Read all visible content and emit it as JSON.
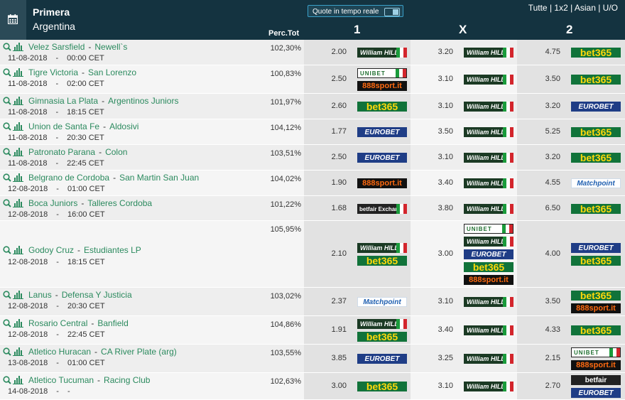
{
  "header": {
    "league": "Primera",
    "country": "Argentina",
    "live_label": "Quote in tempo reale",
    "filters": "Tutte | 1x2 | Asian | U/O",
    "perc_header": "Perc.Tot",
    "col1": "1",
    "colx": "X",
    "col2": "2",
    "icons": [
      "calendar-icon"
    ]
  },
  "bookmakers": {
    "wh": "William HILL",
    "ub": "UNIBET",
    "b365": "bet365",
    "euro": "EUROBET",
    "s888": "888sport.it",
    "mp": "Matchpoint",
    "bf": "betfair Exchange",
    "bf2": "betfair"
  },
  "matches": [
    {
      "home": "Velez Sarsfield",
      "away": "Newell`s",
      "date": "11-08-2018",
      "time": "00:00 CET",
      "perc": "102,30%",
      "o1": "2.00",
      "ox": "3.20",
      "o2": "4.75",
      "b1": [
        "wh"
      ],
      "bx": [
        "wh"
      ],
      "b2": [
        "b365"
      ]
    },
    {
      "home": "Tigre Victoria",
      "away": "San Lorenzo",
      "date": "11-08-2018",
      "time": "02:00 CET",
      "perc": "100,83%",
      "o1": "2.50",
      "ox": "3.10",
      "o2": "3.50",
      "b1": [
        "ub",
        "s888"
      ],
      "bx": [
        "wh"
      ],
      "b2": [
        "b365"
      ]
    },
    {
      "home": "Gimnasia La Plata",
      "away": "Argentinos Juniors",
      "date": "11-08-2018",
      "time": "18:15 CET",
      "perc": "101,97%",
      "o1": "2.60",
      "ox": "3.10",
      "o2": "3.20",
      "b1": [
        "b365"
      ],
      "bx": [
        "wh"
      ],
      "b2": [
        "euro"
      ]
    },
    {
      "home": "Union de Santa Fe",
      "away": "Aldosivi",
      "date": "11-08-2018",
      "time": "20:30 CET",
      "perc": "104,12%",
      "o1": "1.77",
      "ox": "3.50",
      "o2": "5.25",
      "b1": [
        "euro"
      ],
      "bx": [
        "wh"
      ],
      "b2": [
        "b365"
      ]
    },
    {
      "home": "Patronato Parana",
      "away": "Colon",
      "date": "11-08-2018",
      "time": "22:45 CET",
      "perc": "103,51%",
      "o1": "2.50",
      "ox": "3.10",
      "o2": "3.20",
      "b1": [
        "euro"
      ],
      "bx": [
        "wh"
      ],
      "b2": [
        "b365"
      ]
    },
    {
      "home": "Belgrano de Cordoba",
      "away": "San Martin San Juan",
      "date": "12-08-2018",
      "time": "01:00 CET",
      "perc": "104,02%",
      "o1": "1.90",
      "ox": "3.40",
      "o2": "4.55",
      "b1": [
        "s888"
      ],
      "bx": [
        "wh"
      ],
      "b2": [
        "mp"
      ]
    },
    {
      "home": "Boca Juniors",
      "away": "Talleres Cordoba",
      "date": "12-08-2018",
      "time": "16:00 CET",
      "perc": "101,22%",
      "o1": "1.68",
      "ox": "3.80",
      "o2": "6.50",
      "b1": [
        "bf"
      ],
      "bx": [
        "wh"
      ],
      "b2": [
        "b365"
      ]
    },
    {
      "home": "Godoy Cruz",
      "away": "Estudiantes LP",
      "date": "12-08-2018",
      "time": "18:15 CET",
      "perc": "105,95%",
      "o1": "2.10",
      "ox": "3.00",
      "o2": "4.00",
      "b1": [
        "wh",
        "b365"
      ],
      "bx": [
        "ub",
        "wh",
        "euro",
        "b365",
        "s888"
      ],
      "b2": [
        "euro",
        "b365"
      ]
    },
    {
      "home": "Lanus",
      "away": "Defensa Y Justicia",
      "date": "12-08-2018",
      "time": "20:30 CET",
      "perc": "103,02%",
      "o1": "2.37",
      "ox": "3.10",
      "o2": "3.50",
      "b1": [
        "mp"
      ],
      "bx": [
        "wh"
      ],
      "b2": [
        "b365",
        "s888"
      ]
    },
    {
      "home": "Rosario Central",
      "away": "Banfield",
      "date": "12-08-2018",
      "time": "22:45 CET",
      "perc": "104,86%",
      "o1": "1.91",
      "ox": "3.40",
      "o2": "4.33",
      "b1": [
        "wh",
        "b365"
      ],
      "bx": [
        "wh"
      ],
      "b2": [
        "b365"
      ]
    },
    {
      "home": "Atletico Huracan",
      "away": "CA River Plate (arg)",
      "date": "13-08-2018",
      "time": "01:00 CET",
      "perc": "103,55%",
      "o1": "3.85",
      "ox": "3.25",
      "o2": "2.15",
      "b1": [
        "euro"
      ],
      "bx": [
        "wh"
      ],
      "b2": [
        "ub",
        "s888"
      ]
    },
    {
      "home": "Atletico Tucuman",
      "away": "Racing Club",
      "date": "14-08-2018",
      "time": "-",
      "perc": "102,63%",
      "o1": "3.00",
      "ox": "3.10",
      "o2": "2.70",
      "b1": [
        "b365"
      ],
      "bx": [
        "wh"
      ],
      "b2": [
        "bf2",
        "euro"
      ]
    }
  ]
}
